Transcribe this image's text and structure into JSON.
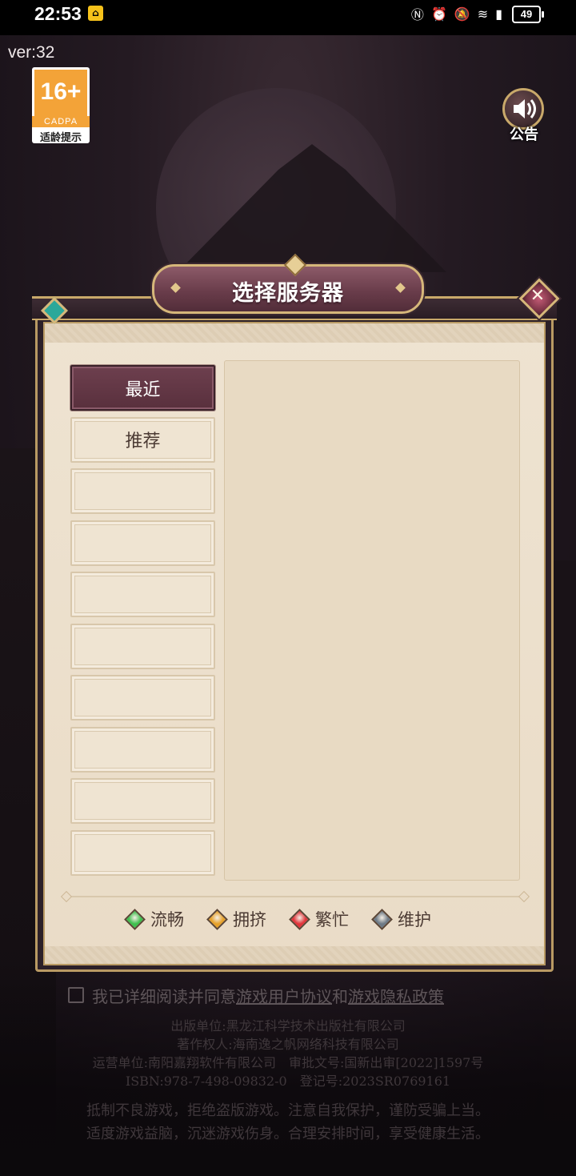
{
  "status_bar": {
    "time": "22:53",
    "battery": "49"
  },
  "version": "ver:32",
  "age_rating": {
    "age": "16+",
    "org": "CADPA",
    "hint": "适龄提示"
  },
  "notice": {
    "label": "公告"
  },
  "panel": {
    "title": "选择服务器",
    "tabs": [
      {
        "label": "最近",
        "active": true
      },
      {
        "label": "推荐",
        "active": false
      },
      {
        "label": "",
        "active": false
      },
      {
        "label": "",
        "active": false
      },
      {
        "label": "",
        "active": false
      },
      {
        "label": "",
        "active": false
      },
      {
        "label": "",
        "active": false
      },
      {
        "label": "",
        "active": false
      },
      {
        "label": "",
        "active": false
      },
      {
        "label": "",
        "active": false
      }
    ],
    "legend": [
      {
        "label": "流畅",
        "color": "#3fbf4f"
      },
      {
        "label": "拥挤",
        "color": "#e6a12a"
      },
      {
        "label": "繁忙",
        "color": "#e0353b"
      },
      {
        "label": "维护",
        "color": "#6d7a86"
      }
    ]
  },
  "agreement": {
    "prefix": "我已详细阅读并同意",
    "link1": "游戏用户协议",
    "conj": "和",
    "link2": "游戏隐私政策"
  },
  "publication_info": [
    "出版单位:黑龙江科学技术出版社有限公司",
    "著作权人:海南逸之帆网络科技有限公司",
    "运营单位:南阳嘉翔软件有限公司　审批文号:国新出审[2022]1597号",
    "ISBN:978-7-498-09832-0　登记号:2023SR0769161"
  ],
  "health_tips": [
    "抵制不良游戏，拒绝盗版游戏。注意自我保护，谨防受骗上当。",
    "适度游戏益脑，沉迷游戏伤身。合理安排时间，享受健康生活。"
  ]
}
